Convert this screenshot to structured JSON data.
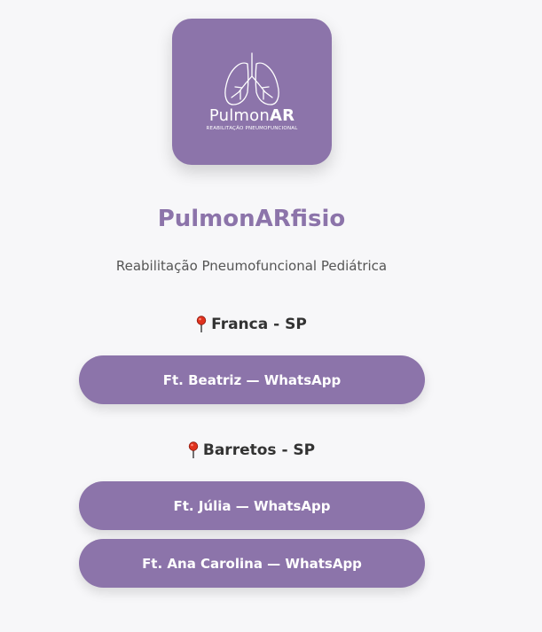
{
  "logo": {
    "word_regular": "Pulmon",
    "word_bold": "AR",
    "tagline": "Reabilitação Pneumofuncional"
  },
  "brand": {
    "title": "PulmonARfisio",
    "subtitle": "Reabilitação Pneumofuncional Pediátrica"
  },
  "locations": [
    {
      "name": "Franca - SP",
      "icon": "round-pushpin-icon",
      "buttons": [
        {
          "label": "Ft. Beatriz — WhatsApp"
        }
      ]
    },
    {
      "name": "Barretos - SP",
      "icon": "round-pushpin-icon",
      "buttons": [
        {
          "label": "Ft. Júlia — WhatsApp"
        },
        {
          "label": "Ft. Ana Carolina — WhatsApp"
        }
      ]
    }
  ],
  "colors": {
    "accent": "#8c74aa",
    "background": "#f7f7f9",
    "text": "#333333",
    "pin": "#e0321e"
  }
}
